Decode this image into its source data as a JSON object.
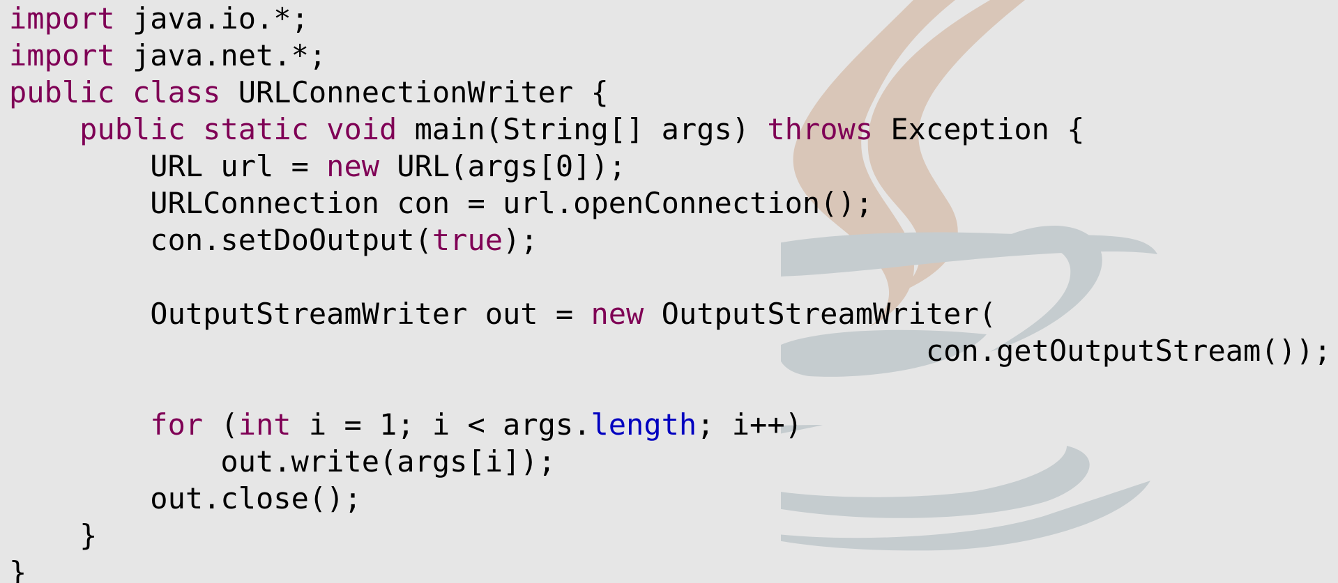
{
  "colors": {
    "background": "#e6e6e6",
    "text": "#000000",
    "keyword": "#7f0055",
    "field": "#0000c0"
  },
  "background_logo": "java-coffee-cup-icon",
  "code_lines": [
    [
      {
        "t": "import",
        "c": "kw"
      },
      {
        "t": " java.io.*;",
        "c": ""
      }
    ],
    [
      {
        "t": "import",
        "c": "kw"
      },
      {
        "t": " java.net.*;",
        "c": ""
      }
    ],
    [
      {
        "t": "public",
        "c": "kw"
      },
      {
        "t": " ",
        "c": ""
      },
      {
        "t": "class",
        "c": "kw"
      },
      {
        "t": " URLConnectionWriter {",
        "c": ""
      }
    ],
    [
      {
        "t": "    ",
        "c": ""
      },
      {
        "t": "public",
        "c": "kw"
      },
      {
        "t": " ",
        "c": ""
      },
      {
        "t": "static",
        "c": "kw"
      },
      {
        "t": " ",
        "c": ""
      },
      {
        "t": "void",
        "c": "kw"
      },
      {
        "t": " main(String[] args) ",
        "c": ""
      },
      {
        "t": "throws",
        "c": "kw"
      },
      {
        "t": " Exception {",
        "c": ""
      }
    ],
    [
      {
        "t": "        URL url = ",
        "c": ""
      },
      {
        "t": "new",
        "c": "kw"
      },
      {
        "t": " URL(args[0]);",
        "c": ""
      }
    ],
    [
      {
        "t": "        URLConnection con = url.openConnection();",
        "c": ""
      }
    ],
    [
      {
        "t": "        con.setDoOutput(",
        "c": ""
      },
      {
        "t": "true",
        "c": "kw"
      },
      {
        "t": ");",
        "c": ""
      }
    ],
    [],
    [
      {
        "t": "        OutputStreamWriter out = ",
        "c": ""
      },
      {
        "t": "new",
        "c": "kw"
      },
      {
        "t": " OutputStreamWriter(",
        "c": ""
      }
    ],
    [
      {
        "t": "                                                    con.getOutputStream());",
        "c": ""
      }
    ],
    [],
    [
      {
        "t": "        ",
        "c": ""
      },
      {
        "t": "for",
        "c": "kw"
      },
      {
        "t": " (",
        "c": ""
      },
      {
        "t": "int",
        "c": "kw"
      },
      {
        "t": " i = 1; i < args.",
        "c": ""
      },
      {
        "t": "length",
        "c": "fld"
      },
      {
        "t": "; i++)",
        "c": ""
      }
    ],
    [
      {
        "t": "            out.write(args[i]);",
        "c": ""
      }
    ],
    [
      {
        "t": "        out.close();",
        "c": ""
      }
    ],
    [
      {
        "t": "    }",
        "c": ""
      }
    ],
    [
      {
        "t": "}",
        "c": ""
      }
    ]
  ]
}
